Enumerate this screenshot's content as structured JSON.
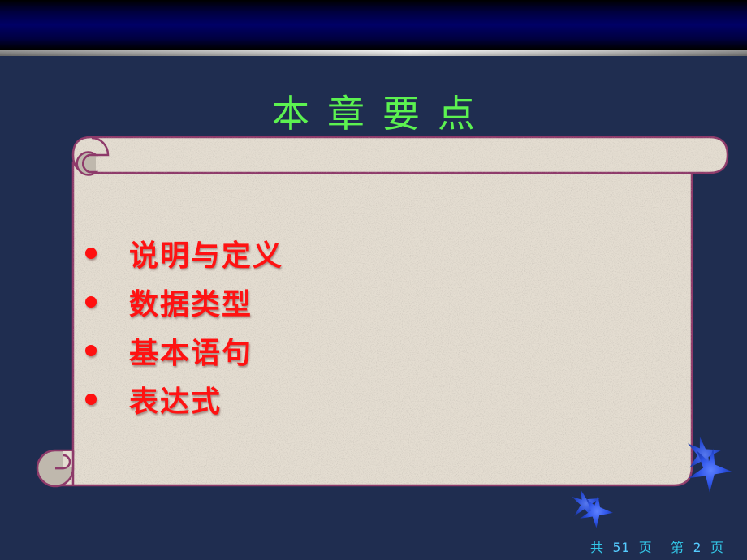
{
  "slide": {
    "title": "本章要点",
    "items": [
      {
        "label": "说明与定义"
      },
      {
        "label": "数据类型"
      },
      {
        "label": "基本语句"
      },
      {
        "label": "表达式"
      }
    ],
    "footer": {
      "total_prefix": "共",
      "total_pages": "51",
      "total_suffix": "页",
      "current_prefix": "第",
      "current_page": "2",
      "current_suffix": "页"
    }
  },
  "colors": {
    "background": "#1f2d50",
    "title": "#5cf250",
    "item_text": "#ff1212",
    "scroll_border": "#8e3a6a",
    "parchment": "#e4ddd1",
    "footer_text": "#33c8e8",
    "star": "#3a5cf0"
  },
  "decorations": {
    "icons": [
      "star-icon",
      "star-icon",
      "star-icon",
      "star-icon"
    ]
  }
}
